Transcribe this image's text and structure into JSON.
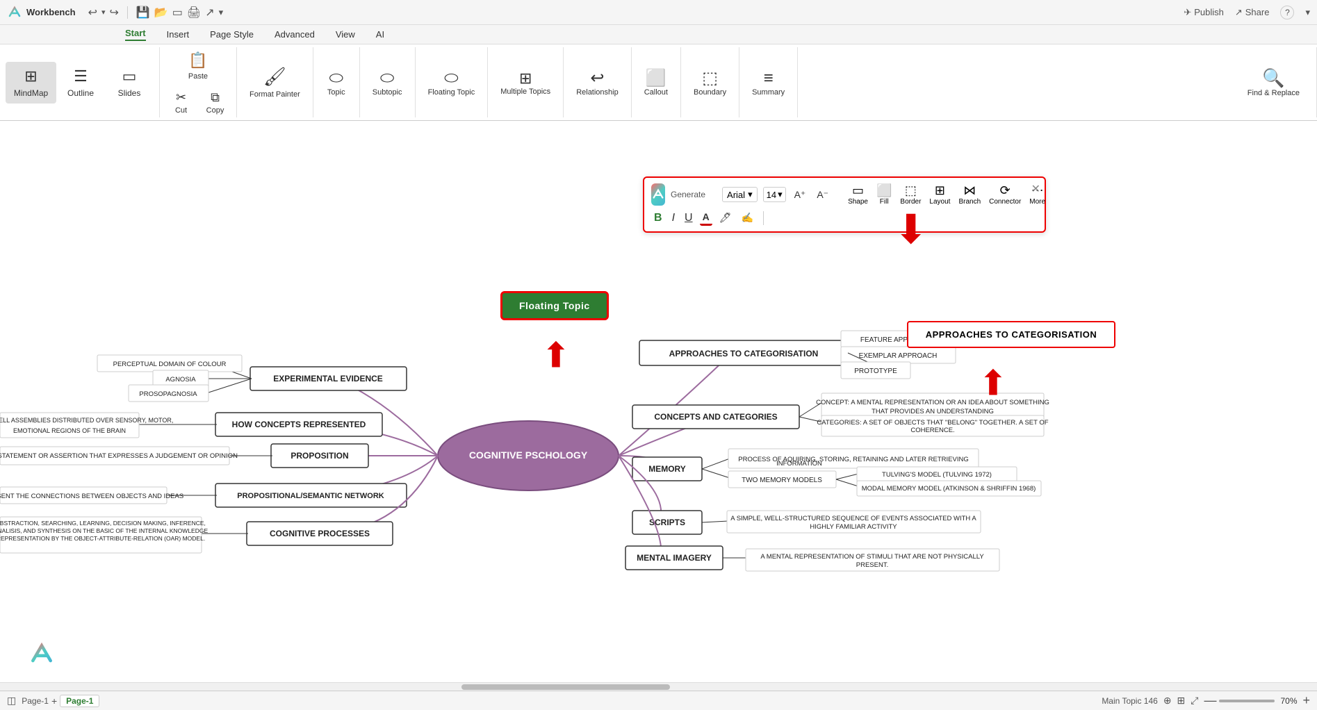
{
  "app": {
    "name": "Workbench",
    "title": "Workbench"
  },
  "titlebar": {
    "app_name": "Workbench",
    "publish": "Publish",
    "share": "Share"
  },
  "menubar": {
    "tabs": [
      "Start",
      "Insert",
      "Page Style",
      "Advanced",
      "View",
      "AI"
    ],
    "active": "Start"
  },
  "ribbon": {
    "view_buttons": [
      {
        "id": "mindmap",
        "label": "MindMap",
        "icon": "⊞",
        "active": true
      },
      {
        "id": "outline",
        "label": "Outline",
        "icon": "☰",
        "active": false
      },
      {
        "id": "slides",
        "label": "Slides",
        "icon": "▭",
        "active": false
      }
    ],
    "paste": {
      "label": "Paste",
      "icon": "📋"
    },
    "cut": {
      "label": "Cut",
      "icon": "✂"
    },
    "copy": {
      "label": "Copy",
      "icon": "⧉"
    },
    "format_painter": {
      "label": "Format Painter",
      "icon": "🖌"
    },
    "topic": {
      "label": "Topic",
      "icon": "⬭"
    },
    "subtopic": {
      "label": "Subtopic",
      "icon": "⬭"
    },
    "floating_topic": {
      "label": "Floating Topic",
      "icon": "⬭"
    },
    "multiple_topics": {
      "label": "Multiple Topics",
      "icon": "⬭⬭"
    },
    "relationship": {
      "label": "Relationship",
      "icon": "↩"
    },
    "callout": {
      "label": "Callout",
      "icon": "⬜"
    },
    "boundary": {
      "label": "Boundary",
      "icon": "⬚"
    },
    "summary": {
      "label": "Summary",
      "icon": "≡"
    },
    "find_replace": {
      "label": "Find & Replace",
      "icon": "🔍"
    }
  },
  "format_toolbar": {
    "generate_label": "Generate",
    "font": "Arial",
    "font_size": "14",
    "shape_label": "Shape",
    "fill_label": "Fill",
    "border_label": "Border",
    "layout_label": "Layout",
    "branch_label": "Branch",
    "connector_label": "Connector",
    "more_label": "More"
  },
  "mindmap": {
    "center": "COGNITIVE PSCHOLOGY",
    "floating_topic": "Floating Topic",
    "highlighted_topic": "APPROACHES TO CATEGORISATION",
    "branches": {
      "right": [
        {
          "label": "APPROACHES TO CATEGORISATION",
          "children": [
            "FEATURE APPROACH",
            "EXEMPLAR APPROACH",
            "PROTOTYPE"
          ]
        },
        {
          "label": "CONCEPTS AND CATEGORIES",
          "detail": "CONCEPT: A MENTAL REPRESENTATION OR AN IDEA ABOUT SOMETHING THAT PROVIDES AN UNDERSTANDING\nCATEGORIES: A SET OF OBJECTS THAT \"BELONG\" TOGETHER. A SET OF COHERENCE."
        },
        {
          "label": "MEMORY",
          "children": [
            "PROCESS OF AQUIRING, STORING, RETAINING AND LATER RETRIEVING INFORMATION",
            {
              "label": "TWO MEMORY MODELS",
              "children": [
                "TULVING'S MODEL (TULVING 1972)",
                "MODAL MEMORY MODEL (ATKINSON & SHRIFFIN 1968)"
              ]
            }
          ]
        },
        {
          "label": "SCRIPTS",
          "detail": "A SIMPLE, WELL-STRUCTURED SEQUENCE OF EVENTS ASSOCIATED WITH A HIGHLY FAMILIAR ACTIVITY"
        },
        {
          "label": "MENTAL IMAGERY",
          "detail": "A MENTAL REPRESENTATION OF STIMULI THAT ARE NOT PHYSICALLY PRESENT."
        }
      ],
      "left": [
        {
          "label": "EXPERIMENTAL EVIDENCE",
          "children": [
            "PERCEPTUAL DOMAIN OF COLOUR",
            "AGNOSIA",
            "PROSOPAGNOSIA"
          ]
        },
        {
          "label": "HOW CONCEPTS REPRESENTED",
          "detail": "ORTICAL CELL ASSEMBLIES DISTRIBUTED OVER SENSORY, MOTOR, EMOTIONAL REGIONS OF THE BRAIN"
        },
        {
          "label": "PROPOSITION",
          "detail": "A STATEMENT OR ASSERTION THAT EXPRESSES A JUDGEMENT OR OPINION"
        },
        {
          "label": "PROPOSITIONAL/SEMANTIC NETWORK",
          "detail": "PRESENT THE CONNECTIONS BETWEEN OBJECTS AND IDEAS"
        },
        {
          "label": "COGNITIVE PROCESSES",
          "detail": "ABSTRACTION, SEARCHING, LEARNING, DECISION MAKING, INFERENCE, ANALISIS, AND SYNTHESIS ON THE BASIC OF THE INTERNAL KNOWLEDGE REPRESENTATION BY THE OBJECT-ATTRIBUTE-RELATION (OAR) MODEL."
        }
      ]
    }
  },
  "statusbar": {
    "page_label": "Page-1",
    "page_tab": "Page-1",
    "main_topic": "Main Topic 146",
    "zoom": "70%",
    "add_page": "+"
  }
}
